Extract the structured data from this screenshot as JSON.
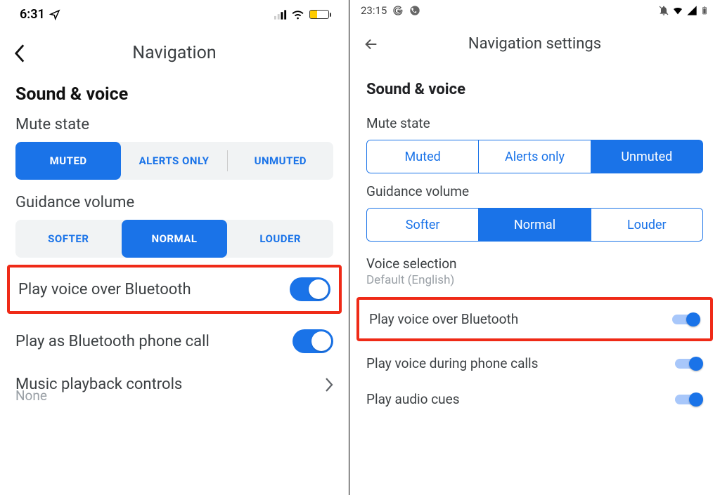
{
  "left": {
    "statusbar": {
      "time": "6:31"
    },
    "header": {
      "title": "Navigation"
    },
    "section_title": "Sound & voice",
    "mute_state_label": "Mute state",
    "mute_options": {
      "muted": "MUTED",
      "alerts": "ALERTS ONLY",
      "unmuted": "UNMUTED"
    },
    "mute_selected": "muted",
    "guidance_label": "Guidance volume",
    "guidance_options": {
      "softer": "SOFTER",
      "normal": "NORMAL",
      "louder": "LOUDER"
    },
    "guidance_selected": "normal",
    "rows": {
      "play_bt": "Play voice over Bluetooth",
      "play_call": "Play as Bluetooth phone call",
      "music_title": "Music playback controls",
      "music_value": "None"
    }
  },
  "right": {
    "statusbar": {
      "time": "23:15"
    },
    "header": {
      "title": "Navigation settings"
    },
    "section_title": "Sound & voice",
    "mute_state_label": "Mute state",
    "mute_options": {
      "muted": "Muted",
      "alerts": "Alerts only",
      "unmuted": "Unmuted"
    },
    "mute_selected": "unmuted",
    "guidance_label": "Guidance volume",
    "guidance_options": {
      "softer": "Softer",
      "normal": "Normal",
      "louder": "Louder"
    },
    "guidance_selected": "normal",
    "voice_selection": {
      "title": "Voice selection",
      "value": "Default (English)"
    },
    "rows": {
      "play_bt": "Play voice over Bluetooth",
      "play_calls": "Play voice during phone calls",
      "audio_cues": "Play audio cues"
    }
  }
}
